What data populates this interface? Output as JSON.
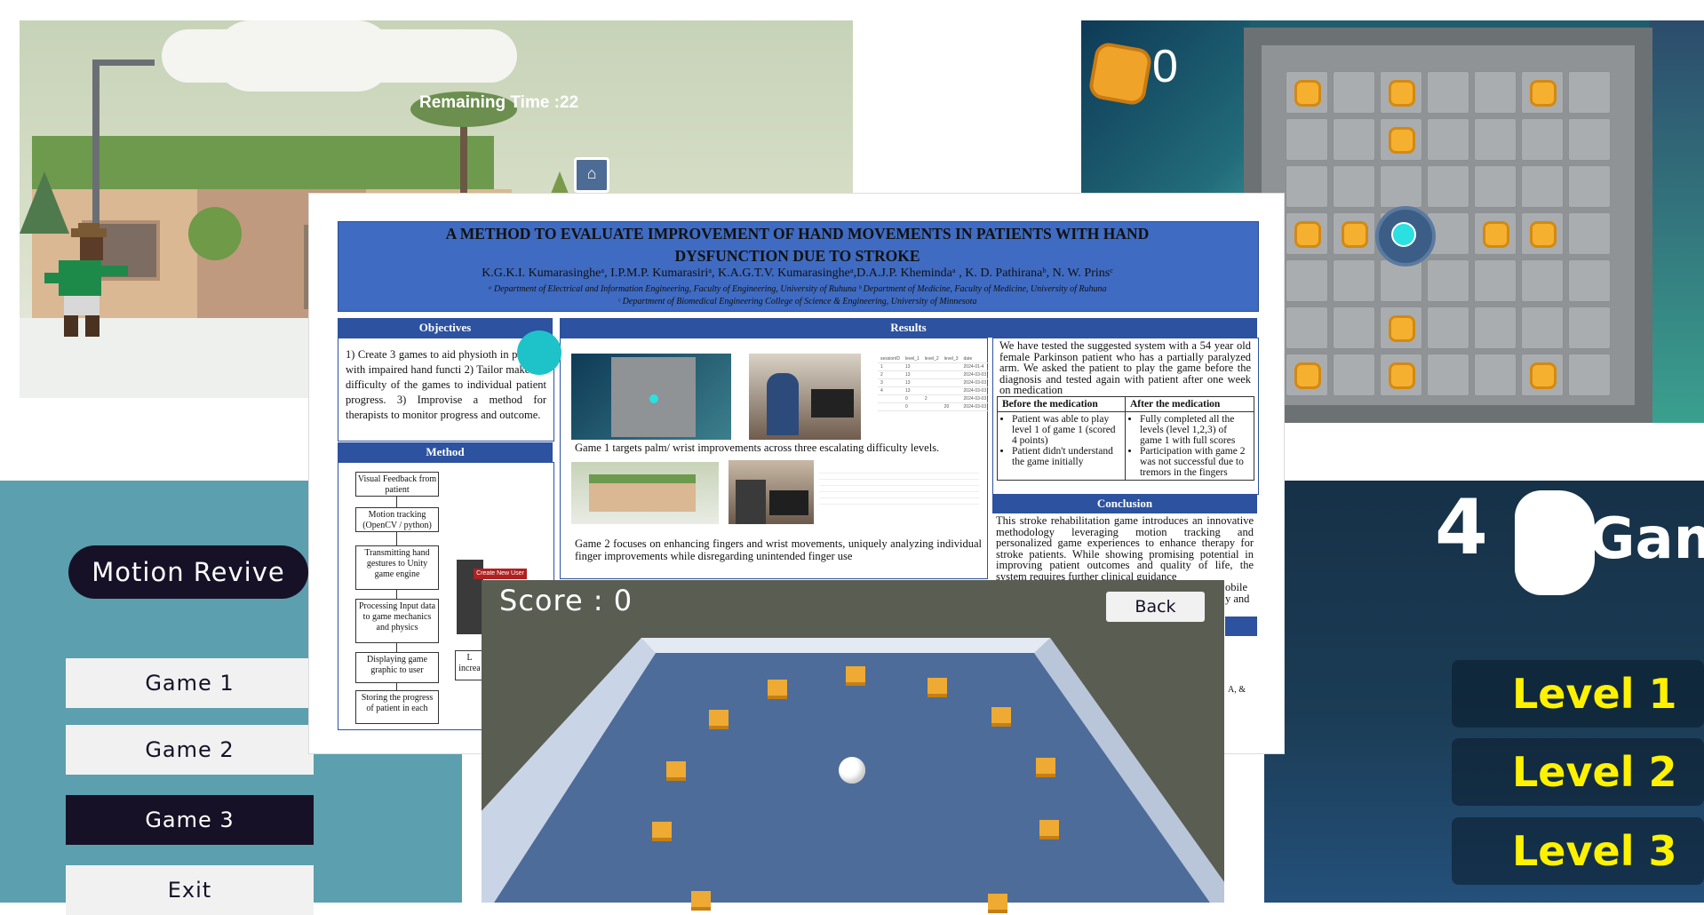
{
  "town_game": {
    "remaining_time": "Remaining Time :22"
  },
  "puzzle_game": {
    "coin_count": "0"
  },
  "menu": {
    "title": "Motion Revive",
    "buttons": [
      "Game 1",
      "Game 2",
      "Game 3",
      "Exit"
    ],
    "active_index": 2
  },
  "level_select": {
    "logo_numeral": "4",
    "logo_word": "Gam",
    "levels": [
      "Level 1",
      "Level 2",
      "Level 3"
    ]
  },
  "poster": {
    "title_line1": "A METHOD TO EVALUATE IMPROVEMENT OF HAND MOVEMENTS IN PATIENTS WITH  HAND",
    "title_line2": "DYSFUNCTION DUE TO STROKE",
    "authors": "K.G.K.I. Kumarasingheᵃ, I.P.M.P. Kumarasiriᵃ, K.A.G.T.V. Kumarasingheᵃ,D.A.J.P. Khemindaᵃ , K. D. Pathiranaᵇ, N. W. Prinsᶜ",
    "affiliation1": "ᵃ Department of Electrical and Information Engineering, Faculty of Engineering, University of Ruhuna ᵇ Department of Medicine, Faculty of Medicine, University of Ruhuna",
    "affiliation2": "ᶜ Department of Biomedical Engineering College of Science & Engineering, University of Minnesota",
    "objectives_heading": "Objectives",
    "objectives_text": "1) Create 3 games to aid physioth in patients with impaired hand functi 2) Tailor make the difficulty of the games to individual patient progress. 3) Improvise a method for therapists to monitor progress and outcome.",
    "method_heading": "Method",
    "method_steps": [
      "Visual Feedback from patient",
      "Motion tracking (OpenCV / python)",
      "Transmitting hand gestures to Unity game engine",
      "Processing Input data to game mechanics and physics",
      "Displaying game graphic to user",
      "Storing the progress of patient in each"
    ],
    "method_side_label": "L increa",
    "create_user_label": "Create New User",
    "results_heading": "Results",
    "game1_caption": "Game 1 targets palm/ wrist improvements across three escalating difficulty levels.",
    "game2_caption": "Game 2 focuses on enhancing fingers and wrist movements, uniquely analyzing individual finger improvements while disregarding unintended finger use",
    "patient_text": "We have tested the suggested system with a 54 year old female Parkinson patient who has a partially paralyzed arm. We asked the patient to play the game before the diagnosis and tested again with patient after one week on medication",
    "compare_headers": [
      "Before the medication",
      "After the medication"
    ],
    "before_items": [
      "Patient was able to play level 1 of game 1 (scored 4 points)",
      "Patient didn't understand the game initially"
    ],
    "after_items": [
      "Fully completed all the levels (level 1,2,3) of game 1 with full scores",
      "Participation with game 2 was not successful due to tremors in the fingers"
    ],
    "conclusion_heading": "Conclusion",
    "conclusion_text": "This stroke rehabilitation game introduces an innovative methodology leveraging motion tracking and personalized game experiences to enhance therapy for stroke patients. While showing promising potential in improving patient outcomes and quality of life, the system requires further clinical guidance",
    "conclusion_tail": "obile y and",
    "ref_tail": "A, &",
    "mini_table1": {
      "headers": [
        "sessionID",
        "level_1",
        "level_2",
        "level_3",
        "date"
      ],
      "rows": [
        [
          "1",
          "13",
          "",
          "",
          "2024-01-4"
        ],
        [
          "2",
          "13",
          "",
          "",
          "2024-03-03"
        ],
        [
          "3",
          "13",
          "",
          "",
          "2024-03-03"
        ],
        [
          "4",
          "13",
          "",
          "",
          "2024-03-03"
        ],
        [
          "",
          "0",
          "2",
          "",
          "2024-03-03"
        ],
        [
          "",
          "0",
          "",
          "20",
          "2024-03-03"
        ]
      ]
    }
  },
  "tilt_game": {
    "score": "Score : 0",
    "back_label": "Back"
  },
  "colors": {
    "menu_dark": "#161126",
    "menu_bg": "#5c9fae",
    "poster_blue": "#2c52a0",
    "level_yellow": "#fff200",
    "accent_cyan": "#1ec3c9"
  }
}
